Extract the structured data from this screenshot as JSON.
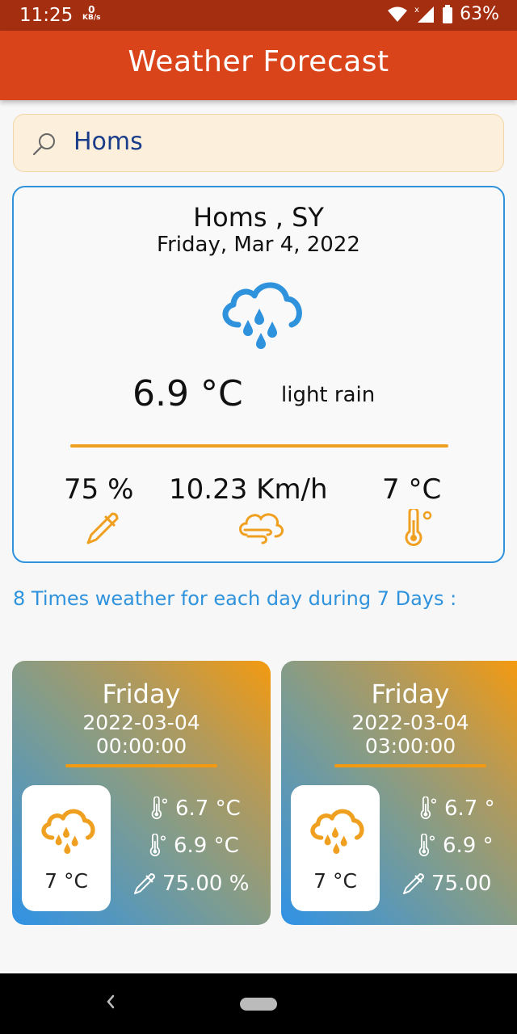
{
  "status_bar": {
    "time": "11:25",
    "speed_value": "0",
    "speed_unit": "KB/s",
    "battery": "63%"
  },
  "app_bar": {
    "title": "Weather Forecast"
  },
  "search": {
    "value": "Homs",
    "icon": "search-icon"
  },
  "current": {
    "city": "Homs , SY",
    "date": "Friday, Mar 4, 2022",
    "icon": "rain-cloud-icon",
    "temperature": "6.9  °C",
    "condition": "light rain",
    "humidity": "75 %",
    "wind": "10.23 Km/h",
    "feels_like": "7 °C",
    "accent_color": "#f0a020",
    "border_color": "#2f92dc"
  },
  "section_title": "8 Times weather for each day during 7 Days :",
  "forecast": [
    {
      "day": "Friday",
      "date": "2022-03-04",
      "time": "00:00:00",
      "temp": "7 °C",
      "min": "6.7  °C",
      "max": "6.9  °C",
      "humidity": "75.00  %"
    },
    {
      "day": "Friday",
      "date": "2022-03-04",
      "time": "03:00:00",
      "temp": "7 °C",
      "min": "6.7  °",
      "max": "6.9  °",
      "humidity": "75.00"
    }
  ],
  "colors": {
    "app_bar": "#d9441a",
    "status_bar": "#a42e10",
    "search_bg": "#fcefdc",
    "icon_blue": "#2f92dc",
    "icon_orange": "#f0a020"
  }
}
